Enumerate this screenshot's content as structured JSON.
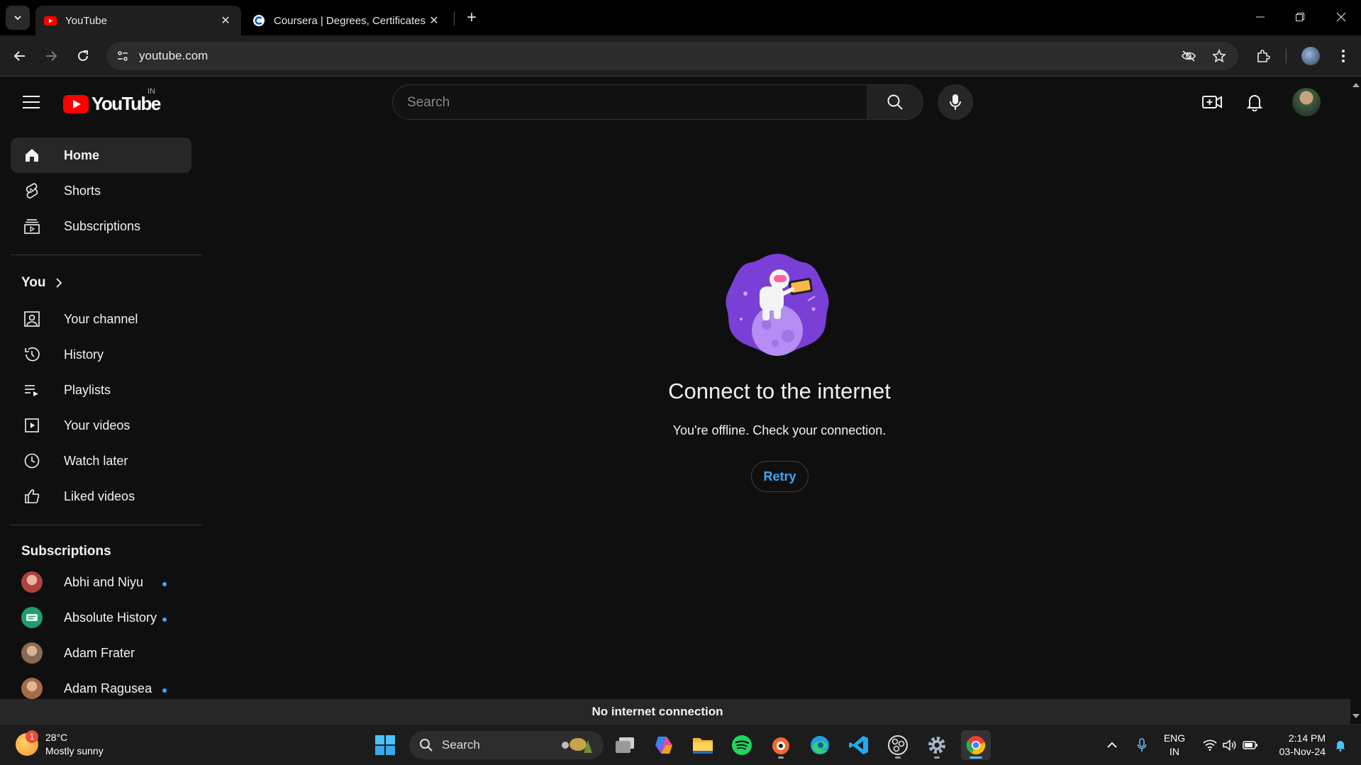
{
  "browser": {
    "tabs": [
      {
        "title": "YouTube",
        "active": true
      },
      {
        "title": "Coursera | Degrees, Certificates",
        "active": false
      }
    ],
    "url": "youtube.com"
  },
  "header": {
    "logo_text": "YouTube",
    "country_code": "IN",
    "search_placeholder": "Search"
  },
  "sidebar": {
    "main": [
      {
        "label": "Home",
        "icon": "home-icon",
        "active": true
      },
      {
        "label": "Shorts",
        "icon": "shorts-icon"
      },
      {
        "label": "Subscriptions",
        "icon": "subscriptions-icon"
      }
    ],
    "you_heading": "You",
    "you_items": [
      {
        "label": "Your channel",
        "icon": "channel-icon"
      },
      {
        "label": "History",
        "icon": "history-icon"
      },
      {
        "label": "Playlists",
        "icon": "playlists-icon"
      },
      {
        "label": "Your videos",
        "icon": "your-videos-icon"
      },
      {
        "label": "Watch later",
        "icon": "watch-later-icon"
      },
      {
        "label": "Liked videos",
        "icon": "liked-icon"
      }
    ],
    "subscriptions_heading": "Subscriptions",
    "subscriptions": [
      {
        "label": "Abhi and Niyu",
        "new": true,
        "avatar_color": "#b0413e"
      },
      {
        "label": "Absolute History",
        "new": true,
        "avatar_color": "#1e9e6e"
      },
      {
        "label": "Adam Frater",
        "new": false,
        "avatar_color": "#8a6a55"
      },
      {
        "label": "Adam Ragusea",
        "new": true,
        "avatar_color": "#a56b4a"
      }
    ]
  },
  "offline": {
    "title": "Connect to the internet",
    "message": "You're offline. Check your connection.",
    "retry_label": "Retry",
    "banner": "No internet connection"
  },
  "taskbar": {
    "weather_temp": "28°C",
    "weather_desc": "Mostly sunny",
    "weather_badge": "1",
    "search_label": "Search",
    "lang_top": "ENG",
    "lang_bottom": "IN",
    "time": "2:14 PM",
    "date": "03-Nov-24"
  },
  "colors": {
    "accent_blue": "#3ea6ff",
    "youtube_red": "#ff0000",
    "background": "#0f0f0f"
  }
}
